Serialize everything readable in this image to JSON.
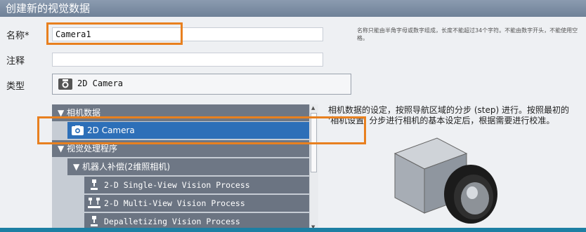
{
  "window": {
    "title": "创建新的视觉数据"
  },
  "form": {
    "name_label": "名称*",
    "name_value": "Camera1",
    "comment_label": "注释",
    "comment_value": "",
    "type_label": "类型",
    "type_value": "2D Camera",
    "hint": "名称只能由半角字母或数字组成，长度不能超过34个字符。不能由数字开头，不能使用空格。"
  },
  "tree": {
    "camera_data": "▼ 相机数据",
    "camera_item": "2D Camera",
    "vision_programs": "▼ 视觉处理程序",
    "robot_comp": "▼ 机器人补偿(2维照相机)",
    "items": [
      "2-D Single-View Vision Process",
      "2-D Multi-View Vision Process",
      "Depalletizing Vision Process"
    ]
  },
  "description": "相机数据的设定，按照导航区域的分步 (step) 进行。按照最初的 '相机设置' 分步进行相机的基本设定后，根据需要进行校准。",
  "colors": {
    "highlight": "#e8801f",
    "selected": "#2d6fb8"
  }
}
